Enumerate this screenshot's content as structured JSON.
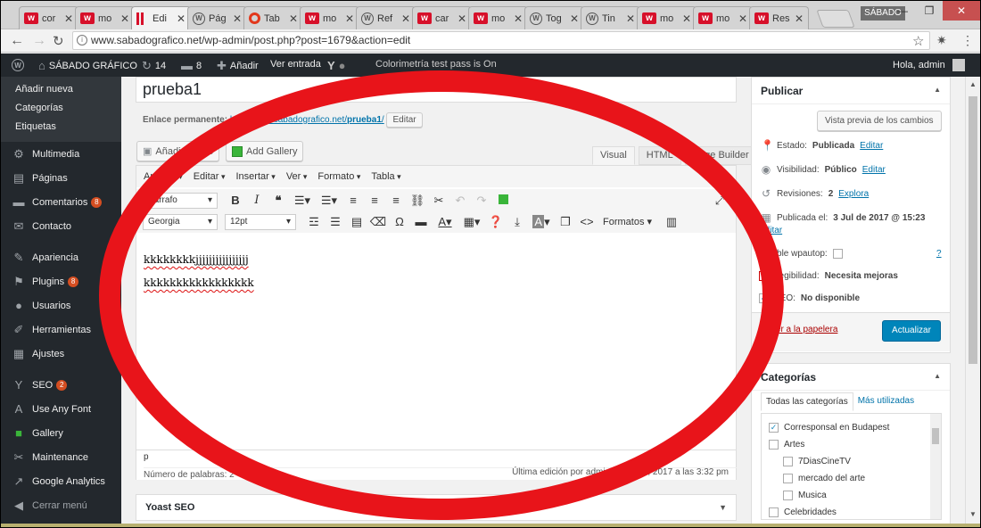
{
  "browser": {
    "tabs": [
      {
        "label": "cor",
        "icon": "w"
      },
      {
        "label": "mo",
        "icon": "w"
      },
      {
        "label": "Edi",
        "icon": "bars"
      },
      {
        "label": "Pág",
        "icon": "wp"
      },
      {
        "label": "Tab",
        "icon": "red"
      },
      {
        "label": "mo",
        "icon": "w"
      },
      {
        "label": "Ref",
        "icon": "wp"
      },
      {
        "label": "car",
        "icon": "w"
      },
      {
        "label": "mo",
        "icon": "w"
      },
      {
        "label": "Tog",
        "icon": "wp"
      },
      {
        "label": "Tin",
        "icon": "wp"
      },
      {
        "label": "mo",
        "icon": "w"
      },
      {
        "label": "mo",
        "icon": "w"
      },
      {
        "label": "Res",
        "icon": "w"
      }
    ],
    "tab_close": "✕",
    "day_badge": "SÁBADO",
    "url": "www.sabadografico.net/wp-admin/post.php?post=1679&action=edit"
  },
  "adminbar": {
    "site": "SÁBADO GRÁFICO",
    "updates": "14",
    "comments": "8",
    "new": "Añadir",
    "view": "Ver entrada",
    "partial": "Colorimetría test pass is On",
    "greeting": "Hola, admin"
  },
  "sidebar": {
    "submenu": [
      "Añadir nueva",
      "Categorías",
      "Etiquetas"
    ],
    "items": [
      {
        "label": "Multimedia",
        "icon": "⚙"
      },
      {
        "label": "Páginas",
        "icon": "▤"
      },
      {
        "label": "Comentarios",
        "icon": "▬",
        "badge": "8"
      },
      {
        "label": "Contacto",
        "icon": "✉"
      },
      {
        "label": "Apariencia",
        "icon": "✎"
      },
      {
        "label": "Plugins",
        "icon": "⚑",
        "badge": "8"
      },
      {
        "label": "Usuarios",
        "icon": "●"
      },
      {
        "label": "Herramientas",
        "icon": "✐"
      },
      {
        "label": "Ajustes",
        "icon": "▦"
      },
      {
        "label": "SEO",
        "icon": "Y",
        "badge": "2"
      },
      {
        "label": "Use Any Font",
        "icon": "A"
      },
      {
        "label": "Gallery",
        "icon": "■"
      },
      {
        "label": "Maintenance",
        "icon": "✂"
      },
      {
        "label": "Google Analytics",
        "icon": "↗"
      },
      {
        "label": "Cerrar menú",
        "icon": "◀"
      }
    ]
  },
  "post": {
    "title": "prueba1",
    "permalink_label": "Enlace permanente:",
    "permalink_base": "http://www.sabadografico.net/",
    "permalink_slug": "prueba1",
    "permalink_end": "/",
    "edit_btn": "Editar",
    "add_media": "Añadir objeto",
    "add_gallery": "Add Gallery",
    "tabs": [
      "Visual",
      "HTML",
      "Page Builder"
    ]
  },
  "editor": {
    "menus": [
      "Archivo",
      "Editar",
      "Insertar",
      "Ver",
      "Formato",
      "Tabla"
    ],
    "block_format": "Párrafo",
    "font_family": "Georgia",
    "font_size": "12pt",
    "formats": "Formatos",
    "lines": [
      "kkkkkkkkjjjjjjjjjjjjjjjj",
      "kkkkkkkkkkkkkkkkk"
    ],
    "path": "p",
    "word_count": "Número de palabras: 2",
    "last_edit": "Última edición por admin el 3 Julio, 2017 a las 3:32 pm"
  },
  "yoast": {
    "title": "Yoast SEO"
  },
  "publish": {
    "title": "Publicar",
    "preview_btn": "Vista previa de los cambios",
    "status_label": "Estado:",
    "status_value": "Publicada",
    "visibility_label": "Visibilidad:",
    "visibility_value": "Público",
    "revisions_label": "Revisiones:",
    "revisions_value": "2",
    "revisions_link": "Explora",
    "published_label": "Publicada el:",
    "published_value": "3 Jul de 2017 @ 15:23",
    "edit_link": "Editar",
    "wpautop_label": "Disable wpautop:",
    "help": "?",
    "readability_label": "Legibilidad:",
    "readability_value": "Necesita mejoras",
    "seo_label": "SEO:",
    "seo_value": "No disponible",
    "trash": "Mover a la papelera",
    "update_btn": "Actualizar"
  },
  "categories": {
    "title": "Categorías",
    "tab_all": "Todas las categorías",
    "tab_used": "Más utilizadas",
    "items": [
      {
        "label": "Corresponsal en Budapest",
        "checked": true,
        "level": 0
      },
      {
        "label": "Artes",
        "checked": false,
        "level": 0
      },
      {
        "label": "7DiasCineTV",
        "checked": false,
        "level": 1
      },
      {
        "label": "mercado del arte",
        "checked": false,
        "level": 1
      },
      {
        "label": "Musica",
        "checked": false,
        "level": 1
      },
      {
        "label": "Celebridades",
        "checked": false,
        "level": 0
      }
    ]
  },
  "colors": {
    "annotation": "#e8141a",
    "wp_blue": "#0085ba",
    "adminbar": "#23282d"
  }
}
